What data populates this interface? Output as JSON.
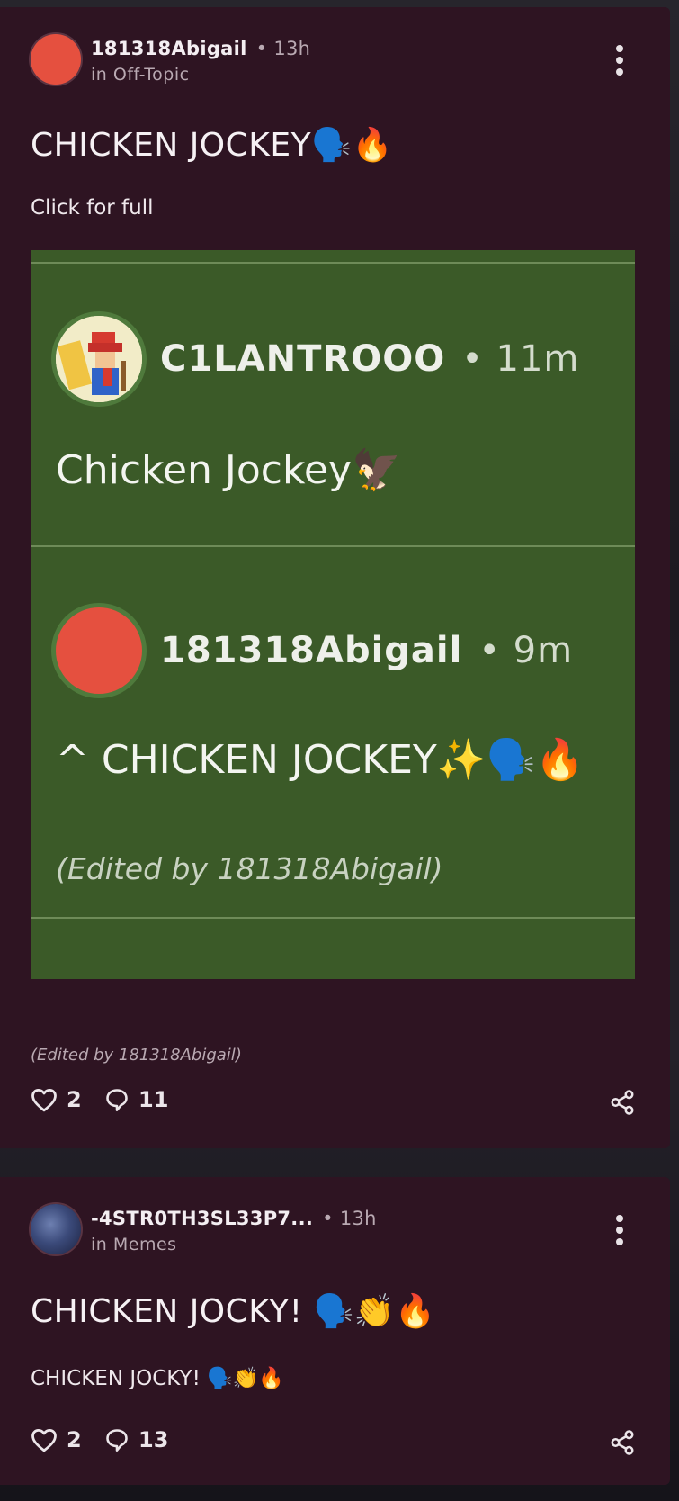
{
  "posts": [
    {
      "author": "181318Abigail",
      "time": "13h",
      "community": "in Off-Topic",
      "title": "CHICKEN JOCKEY🗣️🔥",
      "body": "Click for full",
      "embed": {
        "message1": {
          "author": "C1LANTROOO",
          "time": "11m",
          "text": "Chicken Jockey🦅"
        },
        "message2": {
          "author": "181318Abigail",
          "time": "9m",
          "text": "^ CHICKEN JOCKEY✨🗣️🔥",
          "edited": "(Edited by 181318Abigail)"
        }
      },
      "edited_note": "(Edited by 181318Abigail)",
      "likes": "2",
      "comments": "11",
      "avatar_color": "#e5503f"
    },
    {
      "author": "-4STR0TH3SL33P7...",
      "time": "13h",
      "community": "in Memes",
      "title": "CHICKEN JOCKY! 🗣️👏🔥",
      "body": "CHICKEN JOCKY! 🗣️👏🔥",
      "likes": "2",
      "comments": "13"
    }
  ],
  "icons": {
    "more": "kebab-icon",
    "like": "heart-icon",
    "comment": "comment-icon",
    "share": "share-icon"
  },
  "colors": {
    "card_bg": "#2e1422",
    "embed_bg": "#3b5a28",
    "text": "#f1ecef",
    "muted": "#b9a9b2"
  }
}
